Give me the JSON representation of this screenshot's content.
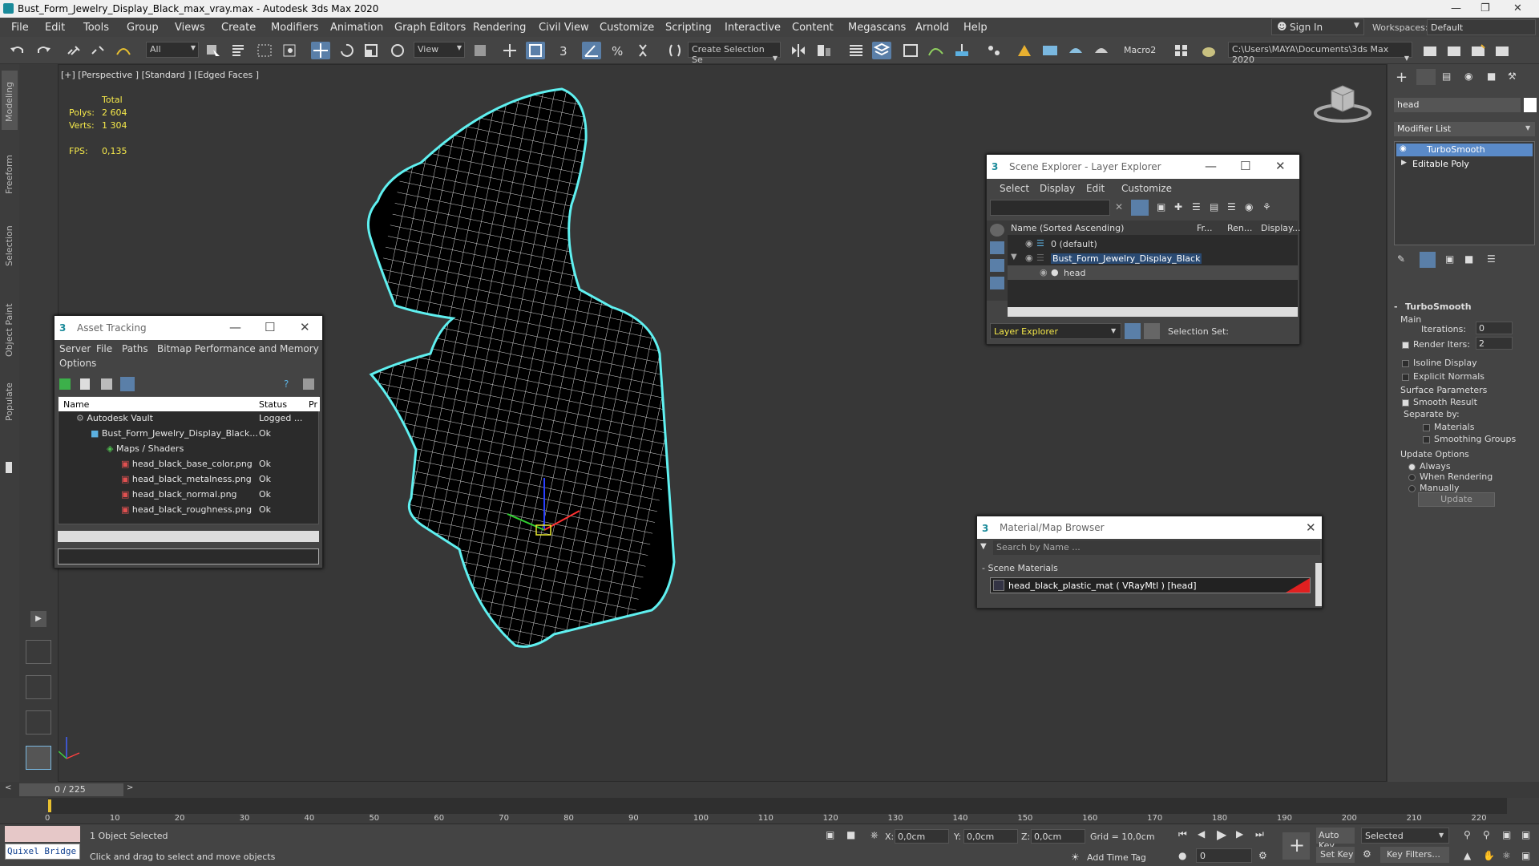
{
  "title_bar": {
    "title": "Bust_Form_Jewelry_Display_Black_max_vray.max - Autodesk 3ds Max 2020"
  },
  "menu": [
    "File",
    "Edit",
    "Tools",
    "Group",
    "Views",
    "Create",
    "Modifiers",
    "Animation",
    "Graph Editors",
    "Rendering",
    "Civil View",
    "Customize",
    "Scripting",
    "Interactive",
    "Content",
    "Megascans",
    "Arnold",
    "Help"
  ],
  "account": {
    "sign_in": "Sign In",
    "workspaces_label": "Workspaces:",
    "workspace": "Default"
  },
  "toolbar": {
    "filter": "All",
    "ref_coord": "View",
    "selection_set": "Create Selection Se",
    "macro": "Macro2",
    "path": "C:\\Users\\MAYA\\Documents\\3ds Max 2020"
  },
  "left_tabs": [
    "Modeling",
    "Freeform",
    "Selection",
    "Object Paint",
    "Populate"
  ],
  "viewport": {
    "label": "[+] [Perspective ] [Standard ] [Edged Faces ]",
    "stats": {
      "total": "Total",
      "polys_label": "Polys:",
      "polys": "2 604",
      "verts_label": "Verts:",
      "verts": "1 304",
      "fps_label": "FPS:",
      "fps": "0,135"
    }
  },
  "asset_tracking": {
    "title": "Asset Tracking",
    "menu": [
      "Server",
      "File",
      "Paths",
      "Bitmap Performance and Memory",
      "Options"
    ],
    "cols": [
      "Name",
      "Status",
      "Pr"
    ],
    "rows": [
      {
        "name": "Autodesk Vault",
        "status": "Logged ..."
      },
      {
        "name": "Bust_Form_Jewelry_Display_Black...",
        "status": "Ok"
      },
      {
        "name": "Maps / Shaders",
        "status": ""
      },
      {
        "name": "head_black_base_color.png",
        "status": "Ok"
      },
      {
        "name": "head_black_metalness.png",
        "status": "Ok"
      },
      {
        "name": "head_black_normal.png",
        "status": "Ok"
      },
      {
        "name": "head_black_roughness.png",
        "status": "Ok"
      }
    ]
  },
  "scene_explorer": {
    "title": "Scene Explorer - Layer Explorer",
    "menu": [
      "Select",
      "Display",
      "Edit",
      "Customize"
    ],
    "cols": [
      "Name (Sorted Ascending)",
      "Fr...",
      "Ren...",
      "Display..."
    ],
    "rows": [
      "0 (default)",
      "Bust_Form_Jewelry_Display_Black",
      "head"
    ],
    "footer_dropdown": "Layer Explorer",
    "selection_set": "Selection Set:"
  },
  "material_browser": {
    "title": "Material/Map Browser",
    "search_placeholder": "Search by Name ...",
    "group": "- Scene Materials",
    "item": "head_black_plastic_mat  ( VRayMtl )  [head]"
  },
  "command_panel": {
    "object_name": "head",
    "modifier_list": "Modifier List",
    "stack": [
      "TurboSmooth",
      "Editable Poly"
    ],
    "rollout": "TurboSmooth",
    "main": "Main",
    "iterations_label": "Iterations:",
    "iterations": "0",
    "render_iters_label": "Render Iters:",
    "render_iters": "2",
    "isoline": "Isoline Display",
    "explicit_normals": "Explicit Normals",
    "surface_params": "Surface Parameters",
    "smooth_result": "Smooth Result",
    "separate_by": "Separate by:",
    "materials": "Materials",
    "smoothing_groups": "Smoothing Groups",
    "update_options": "Update Options",
    "always": "Always",
    "when_rendering": "When Rendering",
    "manually": "Manually",
    "update": "Update"
  },
  "timeline": {
    "frame": "0 / 225",
    "ticks": [
      "0",
      "10",
      "20",
      "30",
      "40",
      "50",
      "60",
      "70",
      "80",
      "90",
      "100",
      "110",
      "120",
      "130",
      "140",
      "150",
      "160",
      "170",
      "180",
      "190",
      "200",
      "210",
      "220"
    ]
  },
  "status": {
    "quixel": "Quixel Bridge",
    "selected": "1 Object Selected",
    "prompt": "Click and drag to select and move objects",
    "x_label": "X:",
    "x": "0,0cm",
    "y_label": "Y:",
    "y": "0,0cm",
    "z_label": "Z:",
    "z": "0,0cm",
    "grid": "Grid = 10,0cm",
    "add_time_tag": "Add Time Tag",
    "auto_key": "Auto Key",
    "set_key": "Set Key",
    "selected_dd": "Selected",
    "key_filters": "Key Filters...",
    "frame_field": "0"
  }
}
